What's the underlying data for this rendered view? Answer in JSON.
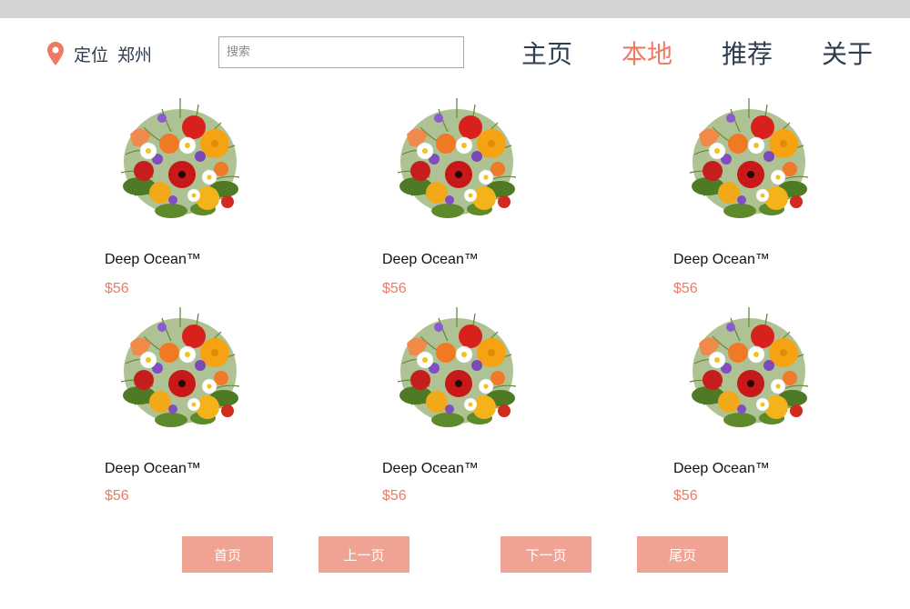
{
  "location": {
    "label": "定位",
    "city": "郑州",
    "icon": "map-pin-icon",
    "icon_color": "#ee7a64"
  },
  "search": {
    "placeholder": "搜索",
    "value": ""
  },
  "nav": {
    "items": [
      {
        "label": "主页",
        "active": false
      },
      {
        "label": "本地",
        "active": true
      },
      {
        "label": "推荐",
        "active": false
      },
      {
        "label": "关于",
        "active": false
      }
    ]
  },
  "products": [
    {
      "name": "Deep Ocean™",
      "price": "$56",
      "image": "flower-bouquet"
    },
    {
      "name": "Deep Ocean™",
      "price": "$56",
      "image": "flower-bouquet"
    },
    {
      "name": "Deep Ocean™",
      "price": "$56",
      "image": "flower-bouquet"
    },
    {
      "name": "Deep Ocean™",
      "price": "$56",
      "image": "flower-bouquet"
    },
    {
      "name": "Deep Ocean™",
      "price": "$56",
      "image": "flower-bouquet"
    },
    {
      "name": "Deep Ocean™",
      "price": "$56",
      "image": "flower-bouquet"
    }
  ],
  "pagination": {
    "first": "首页",
    "prev": "上一页",
    "next": "下一页",
    "last": "尾页"
  },
  "colors": {
    "accent": "#ee7a64",
    "button_bg": "#f1a393",
    "nav_text": "#2e3d4f",
    "top_bar": "#d3d3d3"
  }
}
